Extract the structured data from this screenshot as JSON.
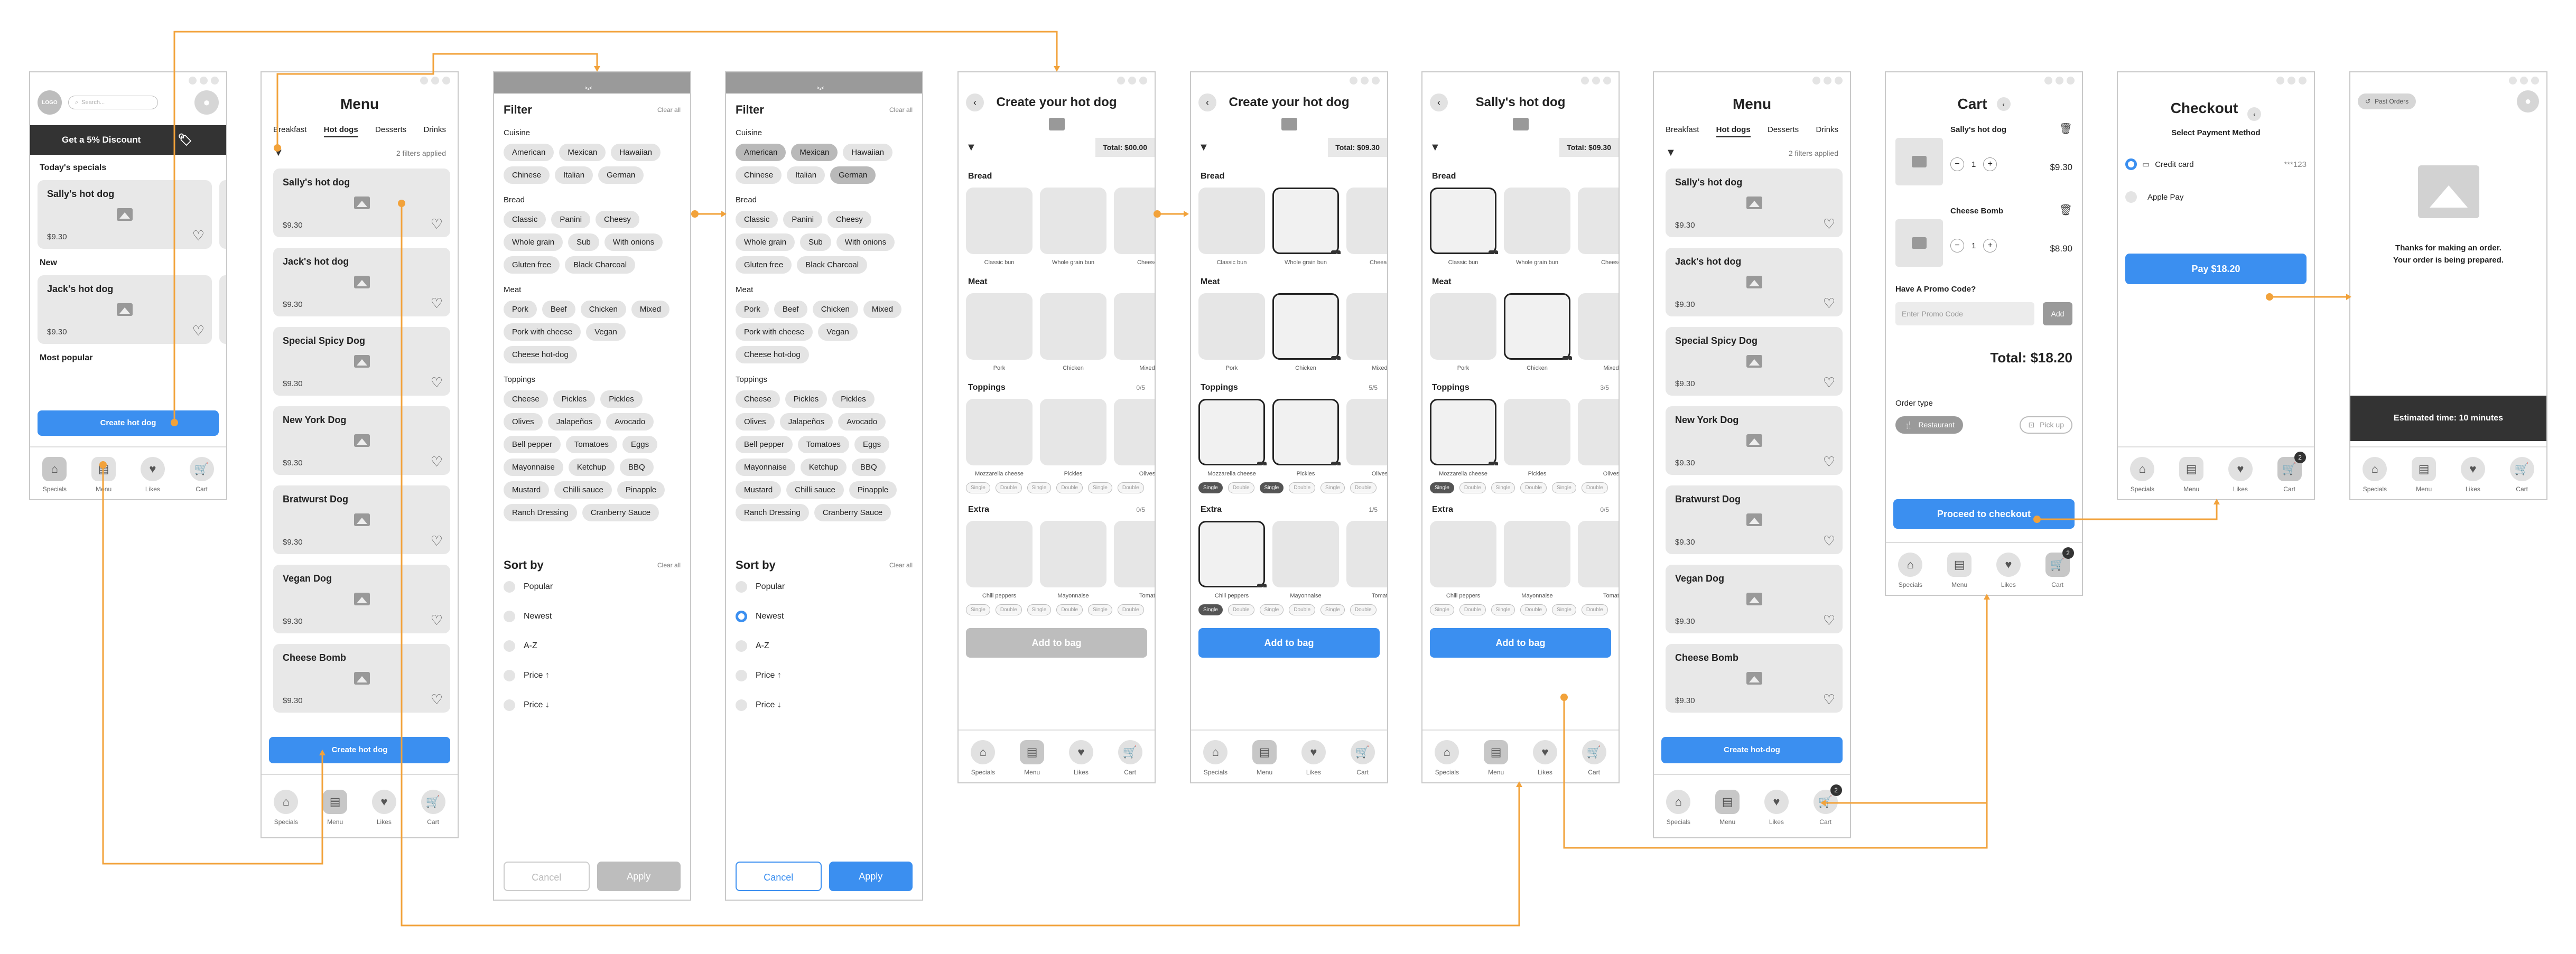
{
  "colors": {
    "accent": "#3b8ff0",
    "connector": "#f2a23a",
    "dark_banner": "#333333"
  },
  "common": {
    "nav": {
      "specials": "Specials",
      "menu": "Menu",
      "likes": "Likes",
      "cart": "Cart",
      "cart_badge": "2"
    },
    "add_to_bag": "Add to bag",
    "create_hot_dog": "Create hot dog",
    "create_hot_dash_dog": "Create hot-dog",
    "single": "Single",
    "double": "Double"
  },
  "specials": {
    "logo": "LOGO",
    "search_placeholder": "Search...",
    "discount": "Get a 5% Discount",
    "today": "Today's specials",
    "new": "New",
    "popular": "Most popular",
    "items": [
      {
        "name": "Sally's hot dog",
        "price": "$9.30"
      },
      {
        "name": "Jack's hot dog",
        "price": "$9.30"
      }
    ]
  },
  "menu": {
    "title": "Menu",
    "tabs": [
      "Breakfast",
      "Hot dogs",
      "Desserts",
      "Drinks"
    ],
    "filters_applied": "2 filters applied",
    "items": [
      {
        "name": "Sally's hot dog",
        "price": "$9.30"
      },
      {
        "name": "Jack's hot dog",
        "price": "$9.30"
      },
      {
        "name": "Special Spicy Dog",
        "price": "$9.30"
      },
      {
        "name": "New York Dog",
        "price": "$9.30"
      },
      {
        "name": "Bratwurst Dog",
        "price": "$9.30"
      },
      {
        "name": "Vegan Dog",
        "price": "$9.30"
      },
      {
        "name": "Cheese Bomb",
        "price": "$9.30"
      }
    ]
  },
  "filter": {
    "title": "Filter",
    "clear": "Clear all",
    "cuisine_label": "Cuisine",
    "cuisine": [
      "American",
      "Mexican",
      "Hawaiian",
      "Chinese",
      "Italian",
      "German"
    ],
    "bread_label": "Bread",
    "bread": [
      "Classic",
      "Panini",
      "Cheesy",
      "Whole grain",
      "Sub",
      "With onions",
      "Gluten free",
      "Black Charcoal"
    ],
    "meat_label": "Meat",
    "meat": [
      "Pork",
      "Beef",
      "Chicken",
      "Mixed",
      "Pork with cheese",
      "Vegan",
      "Cheese hot-dog"
    ],
    "toppings_label": "Toppings",
    "toppings": [
      "Cheese",
      "Pickles",
      "Pickles",
      "Olives",
      "Jalapeños",
      "Avocado",
      "Bell pepper",
      "Tomatoes",
      "Eggs",
      "Mayonnaise",
      "Ketchup",
      "BBQ",
      "Mustard",
      "Chilli sauce",
      "Pinapple",
      "Ranch Dressing",
      "Cranberry Sauce"
    ],
    "sort_label": "Sort by",
    "sort": [
      "Popular",
      "Newest",
      "A-Z",
      "Price ↑",
      "Price ↓"
    ],
    "cancel": "Cancel",
    "apply": "Apply"
  },
  "builder": {
    "title_create": "Create your hot dog",
    "title_sally": "Sally's hot dog",
    "total_zero": "Total: $00.00",
    "total": "Total: $09.30",
    "bread_label": "Bread",
    "meat_label": "Meat",
    "toppings_label": "Toppings",
    "extra_label": "Extra",
    "bread": [
      "Classic bun",
      "Whole grain bun",
      "Cheese"
    ],
    "meat": [
      "Pork",
      "Chicken",
      "Mixed"
    ],
    "toppings": [
      "Mozzarella cheese",
      "Pickles",
      "Olives"
    ],
    "extra": [
      "Chili peppers",
      "Mayonnaise",
      "Tomat"
    ],
    "count_zero": "0/5",
    "count_five": "5/5",
    "count_three": "3/5",
    "count_extra_zero": "0/5",
    "count_extra_one": "1/5"
  },
  "cart": {
    "title": "Cart",
    "items": [
      {
        "name": "Sally's hot dog",
        "qty": "1",
        "price": "$9.30"
      },
      {
        "name": "Cheese Bomb",
        "qty": "1",
        "price": "$8.90"
      }
    ],
    "promo_label": "Have A Promo Code?",
    "promo_placeholder": "Enter Promo Code",
    "promo_add": "Add",
    "total": "Total: $18.20",
    "order_type": "Order type",
    "restaurant": "Restaurant",
    "pickup": "Pick up",
    "proceed": "Proceed to checkout"
  },
  "checkout": {
    "title": "Checkout",
    "select": "Select Payment Method",
    "card": "Credit card",
    "card_mask": "***123",
    "apple": "Apple Pay",
    "pay": "Pay $18.20"
  },
  "confirm": {
    "past_orders": "Past Orders",
    "thanks1": "Thanks for making an order.",
    "thanks2": "Your order is being prepared.",
    "estimated": "Estimated time: 10 minutes"
  }
}
